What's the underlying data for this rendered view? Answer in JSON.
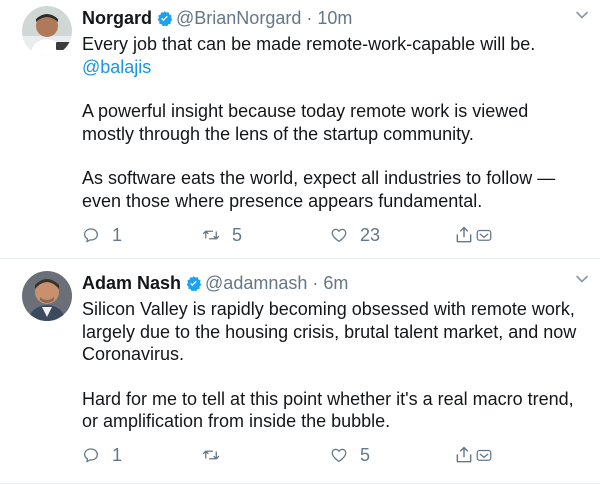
{
  "tweets": [
    {
      "name": "Norgard",
      "handle": "@BrianNorgard",
      "separator": "·",
      "time": "10m",
      "text_line1": "Every job that can be made remote-work-capable will be.",
      "mention": "@balajis",
      "paragraph2": "A powerful insight because today remote work is viewed mostly through the lens of the startup community.",
      "paragraph3": "As software eats the world, expect all industries to follow —even those where presence appears fundamental.",
      "replies": "1",
      "retweets": "5",
      "likes": "23"
    },
    {
      "name": "Adam Nash",
      "handle": "@adamnash",
      "separator": "·",
      "time": "6m",
      "paragraph1": "Silicon Valley is rapidly becoming obsessed with remote work, largely due to the housing crisis, brutal talent market, and now Coronavirus.",
      "paragraph2": "Hard for me to tell at this point whether it's a real macro trend, or amplification from inside the bubble.",
      "replies": "1",
      "retweets": "",
      "likes": "5"
    }
  ],
  "colors": {
    "accent": "#1da1f2",
    "link": "#1b95e0",
    "secondary_text": "#657786",
    "divider": "#e6ecf0"
  },
  "icons": [
    "verified-badge-icon",
    "chevron-down-icon",
    "reply-icon",
    "retweet-icon",
    "like-icon",
    "share-icon"
  ]
}
